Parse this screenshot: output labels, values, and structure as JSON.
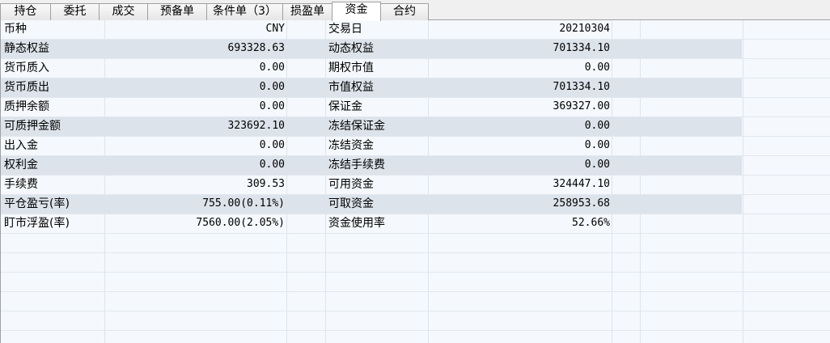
{
  "tabs": [
    {
      "label": "持仓"
    },
    {
      "label": "委托"
    },
    {
      "label": "成交"
    },
    {
      "label": "预备单"
    },
    {
      "label": "条件单（3）"
    },
    {
      "label": "损盈单"
    },
    {
      "label": "资金"
    },
    {
      "label": "合约"
    }
  ],
  "active_tab": "资金",
  "rows": [
    {
      "l1": "币种",
      "v1": "CNY",
      "l2": "交易日",
      "v2": "20210304"
    },
    {
      "l1": "静态权益",
      "v1": "693328.63",
      "l2": "动态权益",
      "v2": "701334.10"
    },
    {
      "l1": "货币质入",
      "v1": "0.00",
      "l2": "期权市值",
      "v2": "0.00"
    },
    {
      "l1": "货币质出",
      "v1": "0.00",
      "l2": "市值权益",
      "v2": "701334.10"
    },
    {
      "l1": "质押余额",
      "v1": "0.00",
      "l2": "保证金",
      "v2": "369327.00"
    },
    {
      "l1": "可质押金额",
      "v1": "323692.10",
      "l2": "冻结保证金",
      "v2": "0.00"
    },
    {
      "l1": "出入金",
      "v1": "0.00",
      "l2": "冻结资金",
      "v2": "0.00"
    },
    {
      "l1": "权利金",
      "v1": "0.00",
      "l2": "冻结手续费",
      "v2": "0.00"
    },
    {
      "l1": "手续费",
      "v1": "309.53",
      "l2": "可用资金",
      "v2": "324447.10"
    },
    {
      "l1": "平仓盈亏(率)",
      "v1": "755.00(0.11%)",
      "l2": "可取资金",
      "v2": "258953.68"
    },
    {
      "l1": "盯市浮盈(率)",
      "v1": "7560.00(2.05%)",
      "l2": "资金使用率",
      "v2": "52.66%"
    }
  ]
}
